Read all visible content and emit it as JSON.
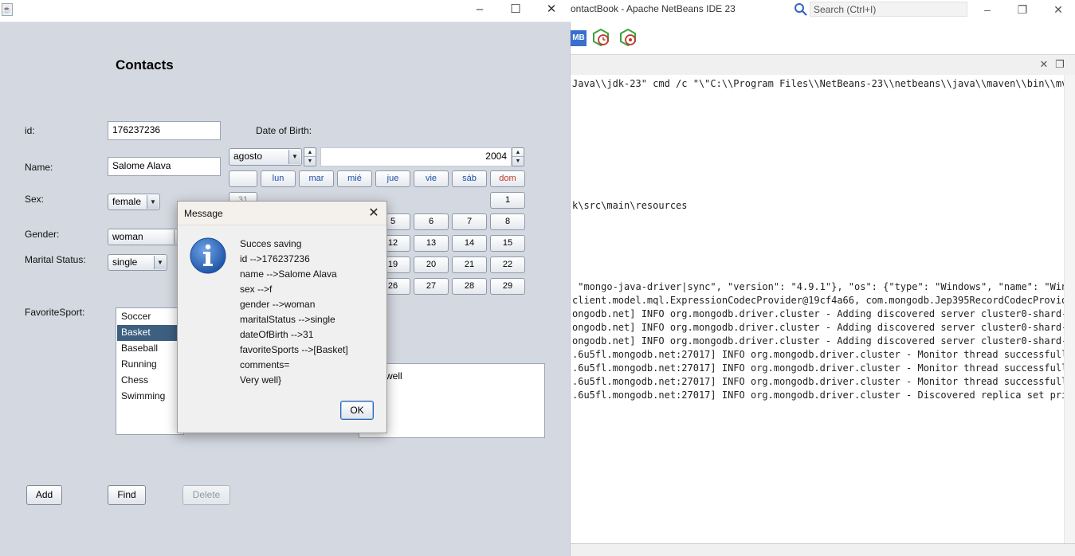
{
  "netbeans": {
    "title": "ontactBook - Apache NetBeans IDE 23",
    "search_placeholder": "Search (Ctrl+I)",
    "toolbar_mb": "MB",
    "output_lines": [
      "Java\\\\jdk-23\" cmd /c \"\\\"C:\\\\Program Files\\\\NetBeans-23\\\\netbeans\\\\java\\\\maven\\\\bin\\\\mvn.c",
      "k\\src\\main\\resources",
      " \"mongo-java-driver|sync\", \"version\": \"4.9.1\"}, \"os\": {\"type\": \"Windows\", \"name\": \"Window",
      "client.model.mql.ExpressionCodecProvider@19cf4a66, com.mongodb.Jep395RecordCodecProvider",
      "ongodb.net] INFO org.mongodb.driver.cluster - Adding discovered server cluster0-shard-00-",
      "ongodb.net] INFO org.mongodb.driver.cluster - Adding discovered server cluster0-shard-00-",
      "ongodb.net] INFO org.mongodb.driver.cluster - Adding discovered server cluster0-shard-00-",
      ".6u5fl.mongodb.net:27017] INFO org.mongodb.driver.cluster - Monitor thread successfully c",
      ".6u5fl.mongodb.net:27017] INFO org.mongodb.driver.cluster - Monitor thread successfully c",
      ".6u5fl.mongodb.net:27017] INFO org.mongodb.driver.cluster - Monitor thread successfully c",
      ".6u5fl.mongodb.net:27017] INFO org.mongodb.driver.cluster - Discovered replica set prima"
    ]
  },
  "form": {
    "heading": "Contacts",
    "labels": {
      "id": "id:",
      "dob": "Date of Birth:",
      "name": "Name:",
      "sex": "Sex:",
      "gender": "Gender:",
      "marital": "Marital Status:",
      "sport": "FavoriteSport:"
    },
    "values": {
      "id": "176237236",
      "name": "Salome Alava",
      "sex": "female",
      "gender": "woman",
      "marital": "single",
      "comments": "well"
    },
    "sports": [
      "Soccer",
      "Basket",
      "Baseball",
      "Running",
      "Chess",
      "Swimming"
    ],
    "selected_sport": "Basket",
    "buttons": {
      "add": "Add",
      "find": "Find",
      "delete": "Delete"
    }
  },
  "calendar": {
    "month": "agosto",
    "year": "2004",
    "headers": [
      "",
      "lun",
      "mar",
      "mié",
      "jue",
      "vie",
      "sáb",
      "dom"
    ],
    "visible_days": {
      "row1": [
        "31",
        "1"
      ],
      "row2": [
        "5",
        "6",
        "7",
        "8"
      ],
      "row3": [
        "12",
        "13",
        "14",
        "15"
      ],
      "row4": [
        "19",
        "20",
        "21",
        "22"
      ],
      "row5": [
        "26",
        "27",
        "28",
        "29"
      ]
    }
  },
  "dialog": {
    "title": "Message",
    "lines": [
      "Succes saving",
      "id -->176237236",
      "name -->Salome Alava",
      "sex -->f",
      "gender -->woman",
      "maritalStatus -->single",
      "dateOfBirth -->31",
      "favoriteSports -->[Basket]",
      "comments=",
      "Very well}"
    ],
    "ok": "OK"
  }
}
